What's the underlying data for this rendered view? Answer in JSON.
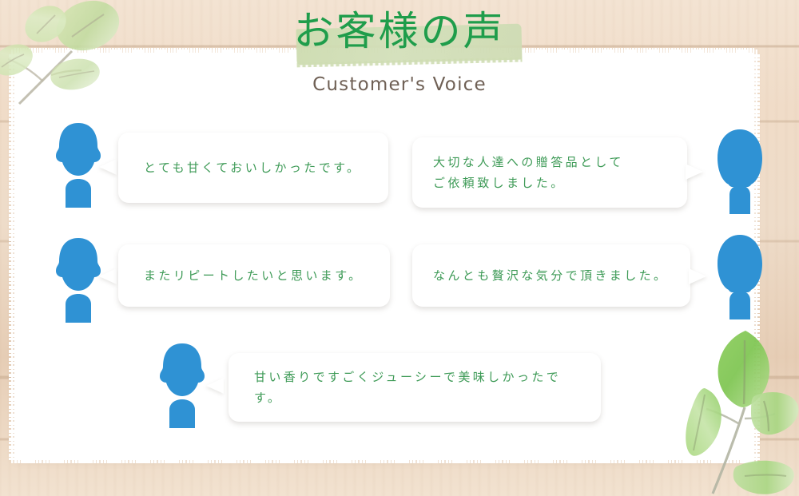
{
  "page": {
    "title_ja": "お客様の声",
    "subtitle_en": "Customer's  Voice"
  },
  "colors": {
    "title_green": "#1f9d4b",
    "band_green": "#cddcb0",
    "subtitle_brown": "#6f6055",
    "bubble_text_green": "#3d9a56",
    "avatar_blue": "#2f92d4",
    "paper_white": "#ffffff",
    "wood_background": "#eedcc9"
  },
  "testimonials": [
    {
      "id": "testimonial-1",
      "side": "left",
      "avatar": "person-male-icon",
      "text": "とても甘くておいしかったです。"
    },
    {
      "id": "testimonial-2",
      "side": "right",
      "avatar": "person-female-icon",
      "text": "大切な人達への贈答品として\nご依頼致しました。"
    },
    {
      "id": "testimonial-3",
      "side": "left",
      "avatar": "person-male-icon",
      "text": "またリピートしたいと思います。"
    },
    {
      "id": "testimonial-4",
      "side": "right",
      "avatar": "person-female-icon",
      "text": "なんとも贅沢な気分で頂きました。"
    },
    {
      "id": "testimonial-5",
      "side": "left",
      "avatar": "person-male-icon",
      "text": "甘い香りですごくジューシーで美味しかったです。"
    }
  ],
  "decorations": [
    {
      "id": "leaves-topleft",
      "name": "watercolor-leaves-pale"
    },
    {
      "id": "leaves-bottomright",
      "name": "watercolor-leaves-green"
    }
  ]
}
